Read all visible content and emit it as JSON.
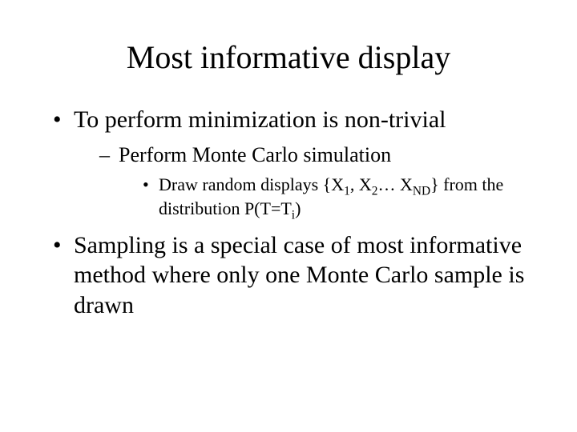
{
  "title": "Most informative display",
  "bullets": {
    "b1": "To perform minimization is non-trivial",
    "b1_1": "Perform Monte Carlo simulation",
    "b1_1_1_pre": "Draw random displays {X",
    "b1_1_1_s1": "1",
    "b1_1_1_mid1": ", X",
    "b1_1_1_s2": "2",
    "b1_1_1_mid2": "… X",
    "b1_1_1_s3": "ND",
    "b1_1_1_mid3": "} from the distribution P(T=T",
    "b1_1_1_s4": "i",
    "b1_1_1_post": ")",
    "b2": "Sampling is a special case of most informative method where only one Monte Carlo sample is drawn"
  }
}
